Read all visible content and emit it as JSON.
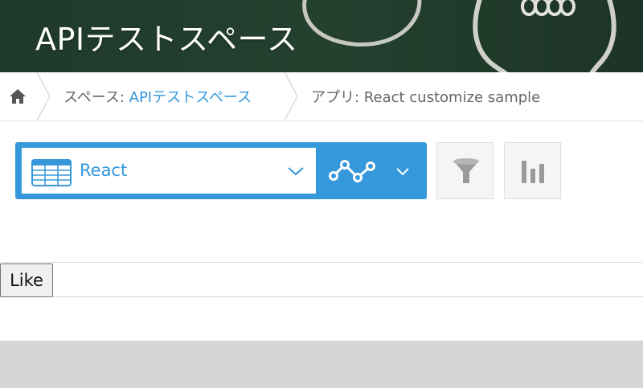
{
  "header": {
    "title": "APIテストスペース"
  },
  "breadcrumb": {
    "home_icon": "home-icon",
    "space_prefix": "スペース: ",
    "space_name": "APIテストスペース",
    "app_prefix": "アプリ: ",
    "app_name": "React customize sample"
  },
  "toolbar": {
    "view_icon": "table-icon",
    "view_label": "React",
    "graph_icon": "line-graph-icon",
    "filter_icon": "funnel-icon",
    "chart_icon": "bar-chart-icon"
  },
  "content": {
    "like_label": "Like"
  },
  "colors": {
    "accent": "#3498db",
    "header_bg": "#24402f",
    "footer_band": "#d6d6d6"
  }
}
